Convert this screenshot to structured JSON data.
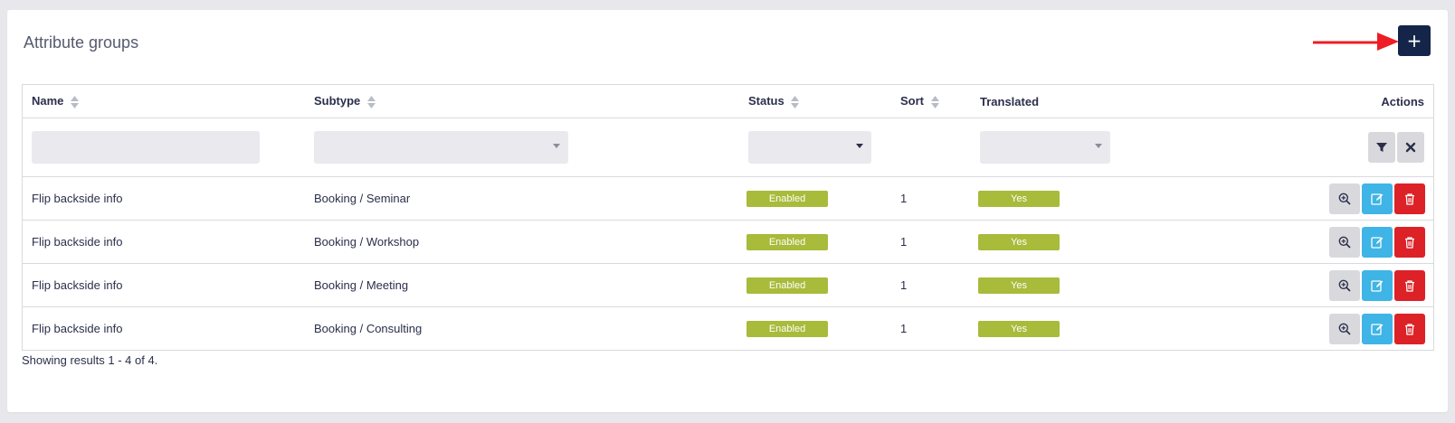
{
  "page": {
    "title": "Attribute groups",
    "add_button_label": "+"
  },
  "table": {
    "headers": {
      "name": "Name",
      "subtype": "Subtype",
      "status": "Status",
      "sort": "Sort",
      "translated": "Translated",
      "actions": "Actions"
    },
    "rows": [
      {
        "name": "Flip backside info",
        "subtype": "Booking / Seminar",
        "status": "Enabled",
        "sort": "1",
        "translated": "Yes"
      },
      {
        "name": "Flip backside info",
        "subtype": "Booking / Workshop",
        "status": "Enabled",
        "sort": "1",
        "translated": "Yes"
      },
      {
        "name": "Flip backside info",
        "subtype": "Booking / Meeting",
        "status": "Enabled",
        "sort": "1",
        "translated": "Yes"
      },
      {
        "name": "Flip backside info",
        "subtype": "Booking / Consulting",
        "status": "Enabled",
        "sort": "1",
        "translated": "Yes"
      }
    ]
  },
  "footer": {
    "results_text": "Showing results 1 - 4 of 4."
  },
  "colors": {
    "primary_button": "#142549",
    "badge": "#a8bb3a",
    "edit": "#3fb4e6",
    "delete": "#dc2127",
    "annotation_arrow": "#ee1c24"
  },
  "icons": {
    "add": "plus-icon",
    "filter": "filter-icon",
    "clear": "close-icon",
    "view": "zoom-in-icon",
    "edit": "edit-icon",
    "delete": "trash-icon"
  }
}
